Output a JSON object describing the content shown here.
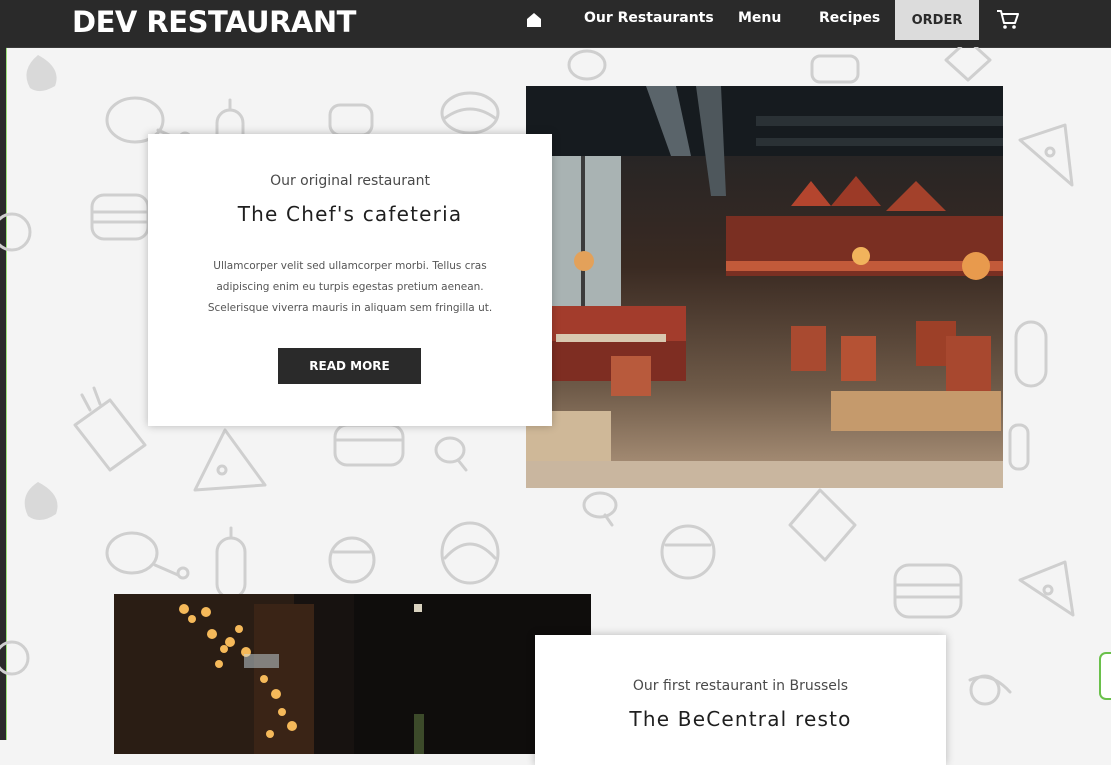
{
  "brand": {
    "name": "DEV RESTAURANT"
  },
  "nav": {
    "home_icon": "home-icon",
    "links": [
      "Our Restaurants",
      "Menu",
      "Recipes"
    ],
    "order_label": "ORDER",
    "cart_icon": "cart-icon"
  },
  "sections": [
    {
      "eyebrow": "Our original restaurant",
      "title": "The Chef's cafeteria",
      "description": [
        "Ullamcorper velit sed ullamcorper morbi. Tellus cras",
        "adipiscing enim eu turpis egestas pretium aenean.",
        "Scelerisque viverra mauris in aliquam sem fringilla ut."
      ],
      "button_label": "READ MORE"
    },
    {
      "eyebrow": "Our first restaurant in Brussels",
      "title": "The BeCentral resto"
    }
  ],
  "colors": {
    "nav_bg": "#2a2a2a",
    "page_bg": "#f4f4f4",
    "card_bg": "#ffffff",
    "accent_green": "#6ac04b"
  }
}
